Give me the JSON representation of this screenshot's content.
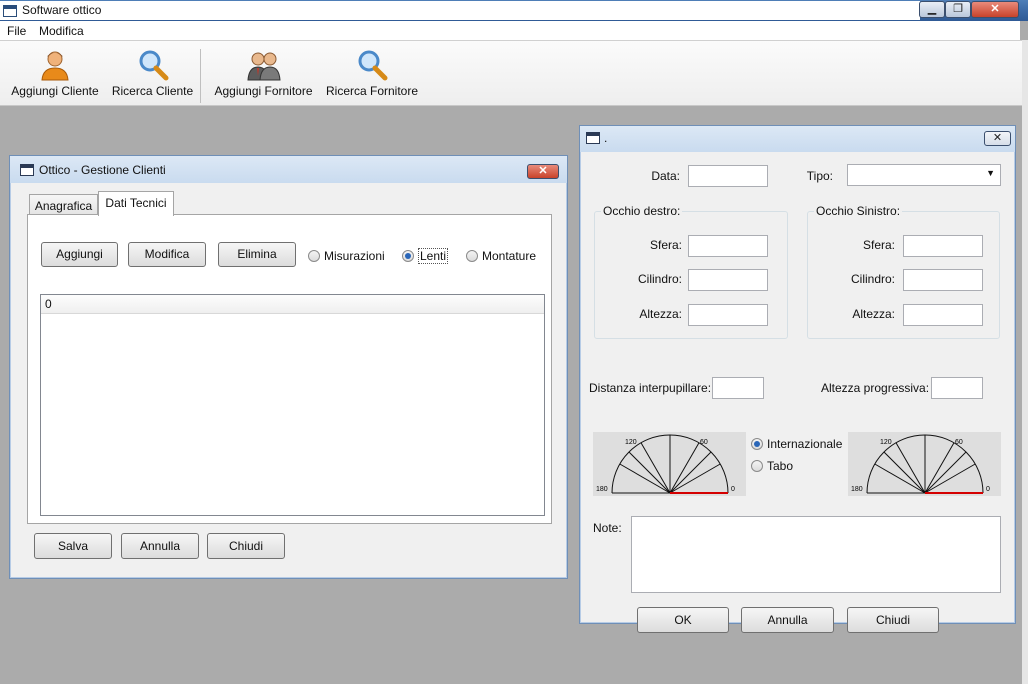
{
  "app": {
    "title": "Software ottico",
    "menu": [
      "File",
      "Modifica"
    ],
    "window_buttons": {
      "minimize": "▁",
      "maximize": "❐",
      "close": "✕"
    }
  },
  "toolbar": {
    "items": [
      {
        "label": "Aggiungi Cliente",
        "icon": "user-icon"
      },
      {
        "label": "Ricerca Cliente",
        "icon": "magnifier-icon"
      },
      {
        "label": "Aggiungi Fornitore",
        "icon": "users-group-icon"
      },
      {
        "label": "Ricerca Fornitore",
        "icon": "magnifier-icon"
      }
    ]
  },
  "clienti": {
    "title": "Ottico - Gestione Clienti",
    "tabs": [
      "Anagrafica",
      "Dati Tecnici"
    ],
    "active_tab": "Dati Tecnici",
    "buttons": {
      "add": "Aggiungi",
      "edit": "Modifica",
      "delete": "Elimina"
    },
    "radios": [
      {
        "label": "Misurazioni",
        "checked": false
      },
      {
        "label": "Lenti",
        "checked": true
      },
      {
        "label": "Montature",
        "checked": false
      }
    ],
    "list_first_row": "0",
    "footer": {
      "save": "Salva",
      "cancel": "Annulla",
      "close": "Chiudi"
    }
  },
  "dettaglio": {
    "title": ".",
    "data_label": "Data:",
    "tipo_label": "Tipo:",
    "tipo_value": "",
    "occhio_destro": {
      "title": "Occhio destro:",
      "sfera": "Sfera:",
      "cilindro": "Cilindro:",
      "altezza": "Altezza:"
    },
    "occhio_sinistro": {
      "title": "Occhio Sinistro:",
      "sfera": "Sfera:",
      "cilindro": "Cilindro:",
      "altezza": "Altezza:"
    },
    "distanza_label": "Distanza interpupillare:",
    "altezza_prog_label": "Altezza progressiva:",
    "axis_scale": {
      "t0": "0",
      "t60": "60",
      "t120": "120",
      "t180": "180"
    },
    "axis_mode": [
      {
        "label": "Internazionale",
        "checked": true
      },
      {
        "label": "Tabo",
        "checked": false
      }
    ],
    "note_label": "Note:",
    "buttons": {
      "ok": "OK",
      "cancel": "Annulla",
      "close": "Chiudi"
    },
    "accent_color": "#d40000"
  }
}
